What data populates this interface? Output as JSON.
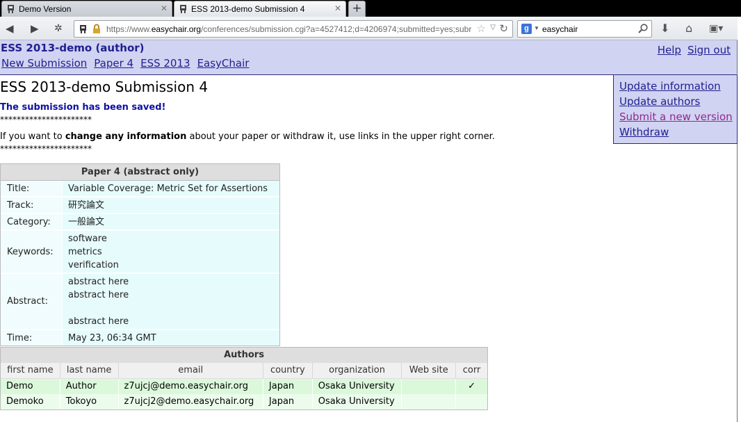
{
  "browser": {
    "tabs": [
      {
        "label": "Demo Version",
        "active": false
      },
      {
        "label": "ESS 2013-demo Submission 4",
        "active": true
      }
    ],
    "url_prefix": "https://www.",
    "url_domain": "easychair.org",
    "url_rest": "/conferences/submission.cgi?a=4527412;d=4206974;submitted=yes;subr",
    "search_engine_icon": "google-icon",
    "search_value": "easychair"
  },
  "header": {
    "title": "ESS 2013-demo (author)",
    "menu": [
      "New Submission",
      "Paper 4",
      "ESS 2013",
      "EasyChair"
    ],
    "help": "Help",
    "signout": "Sign out"
  },
  "submenu": [
    "Update information",
    "Update authors",
    "Submit a new version",
    "Withdraw"
  ],
  "page": {
    "heading": "ESS 2013-demo Submission 4",
    "saved_message": "The submission has been saved!",
    "stars": "**********************",
    "info_before": "If you want to ",
    "info_bold": "change any information",
    "info_after": " about your paper or withdraw it, use links in the upper right corner."
  },
  "paper": {
    "header": "Paper 4 (abstract only)",
    "title_label": "Title:",
    "title": "Variable Coverage: Metric Set for Assertions",
    "track_label": "Track:",
    "track": "研究論文",
    "category_label": "Category:",
    "category": "一般論文",
    "keywords_label": "Keywords:",
    "keywords": [
      "software",
      "metrics",
      "verification"
    ],
    "abstract_label": "Abstract:",
    "abstract_lines": [
      "abstract here",
      "abstract here",
      "",
      "abstract here"
    ],
    "time_label": "Time:",
    "time": "May 23, 06:34 GMT"
  },
  "authors": {
    "header": "Authors",
    "columns": [
      "first name",
      "last name",
      "email",
      "country",
      "organization",
      "Web site",
      "corr"
    ],
    "rows": [
      {
        "first": "Demo",
        "last": "Author",
        "email": "z7ujcj@demo.easychair.org",
        "country": "Japan",
        "org": "Osaka University",
        "web": "",
        "corr": "✓"
      },
      {
        "first": "Demoko",
        "last": "Tokoyo",
        "email": "z7ujcj2@demo.easychair.org",
        "country": "Japan",
        "org": "Osaka University",
        "web": "",
        "corr": ""
      }
    ]
  }
}
